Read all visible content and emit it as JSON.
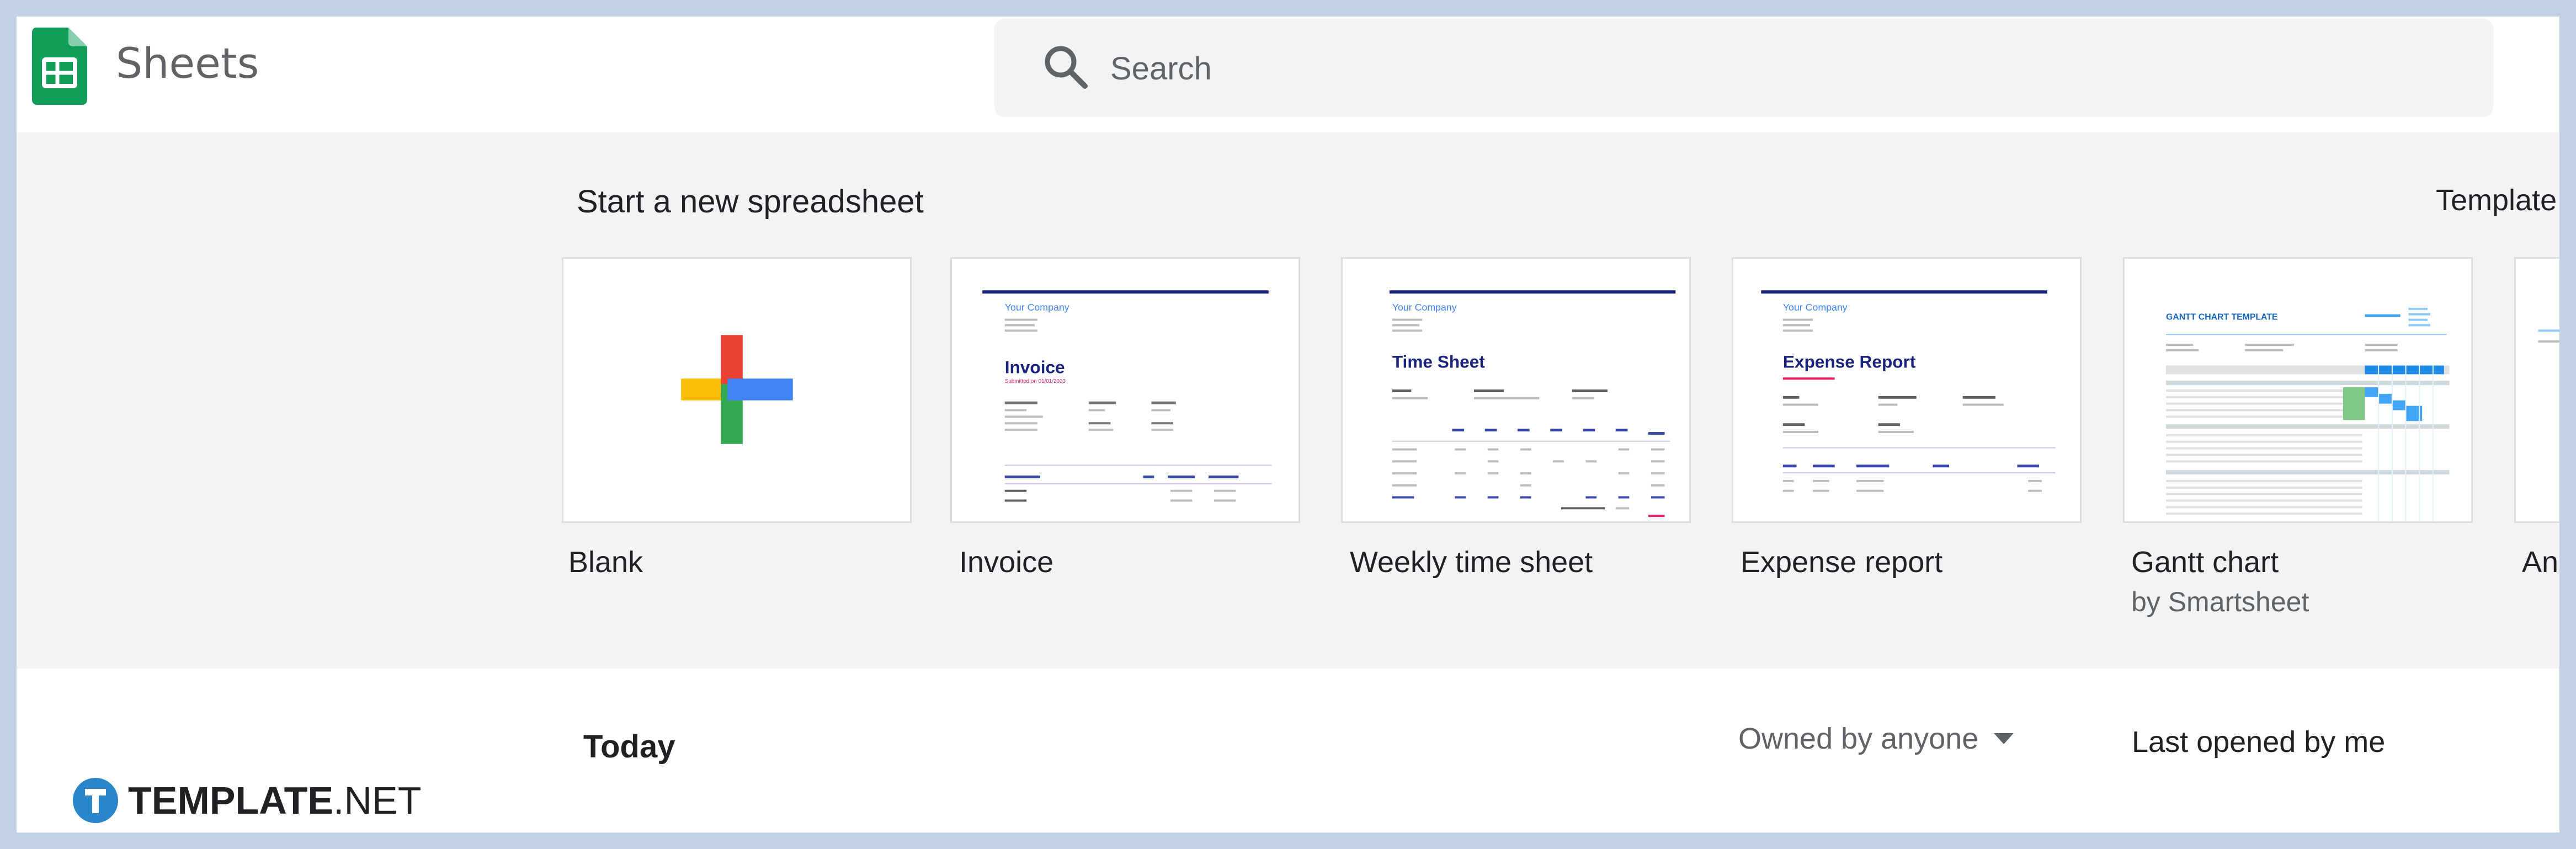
{
  "app": {
    "name": "Sheets"
  },
  "search": {
    "placeholder": "Search"
  },
  "gallery": {
    "heading": "Start a new spreadsheet",
    "link_label": "Template",
    "templates": [
      {
        "label": "Blank"
      },
      {
        "label": "Invoice"
      },
      {
        "label": "Weekly time sheet"
      },
      {
        "label": "Expense report"
      },
      {
        "label": "Gantt chart",
        "sublabel": "by Smartsheet"
      },
      {
        "label": "An"
      }
    ],
    "previews": {
      "invoice": {
        "company": "Your Company",
        "title": "Invoice",
        "subtitle": "Submitted on 01/01/2023"
      },
      "timesheet": {
        "company": "Your Company",
        "title": "Time Sheet"
      },
      "expense": {
        "company": "Your Company",
        "title": "Expense Report"
      },
      "gantt": {
        "title": "GANTT CHART TEMPLATE"
      }
    }
  },
  "recent": {
    "title": "Today",
    "owner_filter": "Owned by anyone",
    "sort_filter": "Last opened by me"
  },
  "watermark": {
    "brand": "TEMPLATE",
    "suffix": ".NET"
  },
  "colors": {
    "sheets_green": "#0f9d58",
    "google_red": "#ea4335",
    "google_blue": "#4285f4",
    "google_yellow": "#fbbc04",
    "google_green": "#34a853",
    "watermark_blue": "#2a86c8"
  }
}
